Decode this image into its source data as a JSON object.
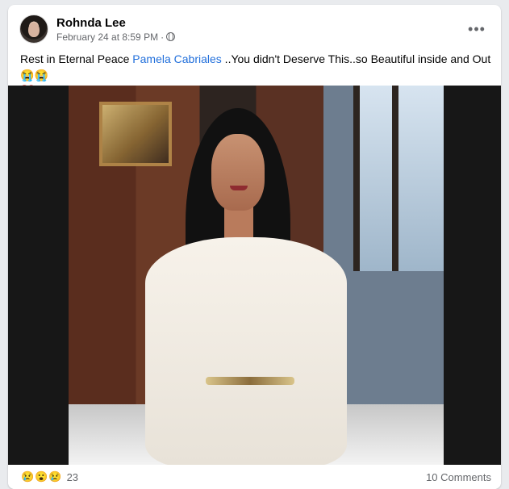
{
  "post": {
    "author": "Rohnda Lee",
    "timestamp": "February 24 at 8:59 PM",
    "separator": "·",
    "privacy_icon": "globe-icon",
    "more_label": "•••",
    "text": {
      "before_mention": "Rest in Eternal Peace ",
      "mention": "Pamela Cabriales",
      "after_mention": " ..You didn't Deserve This..so Beautiful inside and Out",
      "emoji_1": "😭",
      "emoji_2": "😭",
      "heart": "💔"
    }
  },
  "footer": {
    "reaction_1": "😢",
    "reaction_2": "😮",
    "reaction_3": "😢",
    "reaction_count": "23",
    "comments_label": "10 Comments"
  }
}
